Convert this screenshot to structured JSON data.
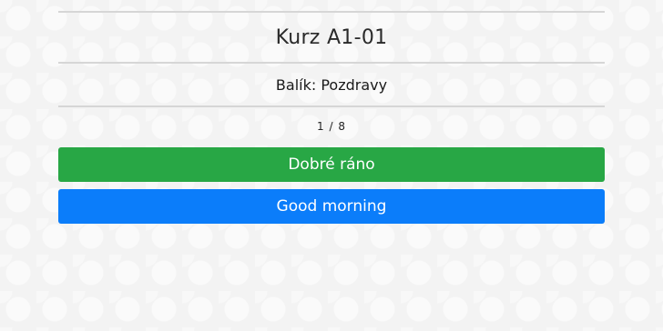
{
  "course": {
    "title": "Kurz A1-01"
  },
  "package": {
    "label": "Balík: Pozdravy"
  },
  "progress": {
    "current": 1,
    "total": 8,
    "text": "1 / 8"
  },
  "cards": {
    "source": {
      "text": "Dobré ráno",
      "color": "#28a745"
    },
    "target": {
      "text": "Good morning",
      "color": "#0b7dfa"
    }
  }
}
